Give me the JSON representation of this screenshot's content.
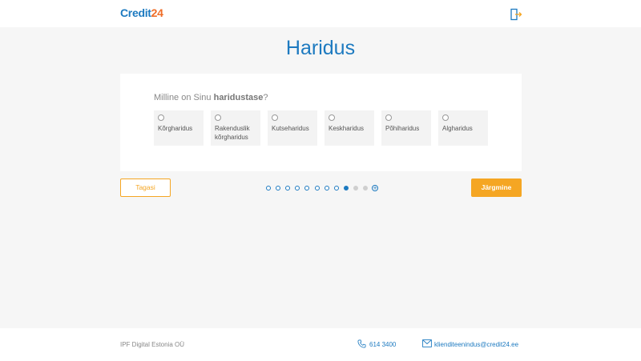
{
  "header": {
    "logo_part1": "Credit",
    "logo_part2": "24",
    "logout_icon": "logout-icon"
  },
  "page": {
    "title": "Haridus"
  },
  "question": {
    "prefix": "Milline on Sinu ",
    "emphasis": "haridustase",
    "suffix": "?"
  },
  "options": [
    {
      "label": "Kõrgharidus"
    },
    {
      "label": "Rakenduslik kõrgharidus"
    },
    {
      "label": "Kutseharidus"
    },
    {
      "label": "Keskharidus"
    },
    {
      "label": "Põhiharidus"
    },
    {
      "label": "Algharidus"
    }
  ],
  "nav": {
    "back_label": "Tagasi",
    "next_label": "Järgmine"
  },
  "progress": {
    "total_steps": 12,
    "current_step": 9
  },
  "footer": {
    "company": "IPF Digital Estonia OÜ",
    "phone": "614 3400",
    "email": "klienditeenindus@credit24.ee"
  },
  "colors": {
    "brand_blue": "#1d7ac0",
    "brand_orange": "#f5a623",
    "logo_orange": "#ef6d27"
  }
}
